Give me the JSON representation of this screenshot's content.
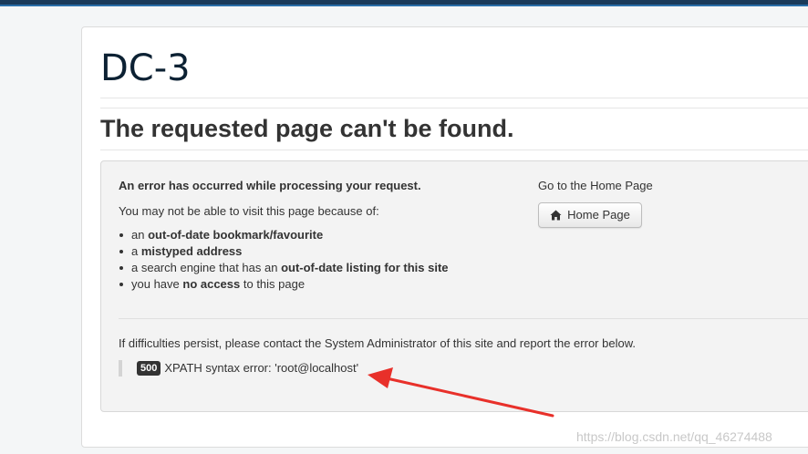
{
  "site": {
    "title": "DC-3"
  },
  "error_page": {
    "heading": "The requested page can't be found.",
    "lead": "An error has occurred while processing your request.",
    "intro": "You may not be able to visit this page because of:",
    "reasons": [
      {
        "prefix": "an ",
        "bold": "out-of-date bookmark/favourite",
        "suffix": ""
      },
      {
        "prefix": "a ",
        "bold": "mistyped address",
        "suffix": ""
      },
      {
        "prefix": "a search engine that has an ",
        "bold": "out-of-date listing for this site",
        "suffix": ""
      },
      {
        "prefix": "you have ",
        "bold": "no access",
        "suffix": " to this page"
      }
    ],
    "home_heading": "Go to the Home Page",
    "home_button_label": "Home Page",
    "home_icon": "home-icon",
    "persist_text": "If difficulties persist, please contact the System Administrator of this site and report the error below.",
    "error_code": "500",
    "error_message": "XPATH syntax error: 'root@localhost'"
  },
  "annotation": {
    "arrow_color": "#e8302a"
  },
  "watermark": "https://blog.csdn.net/qq_46274488",
  "colors": {
    "top_bar": "#1a3a5a",
    "title": "#0c2133",
    "badge": "#333333"
  }
}
